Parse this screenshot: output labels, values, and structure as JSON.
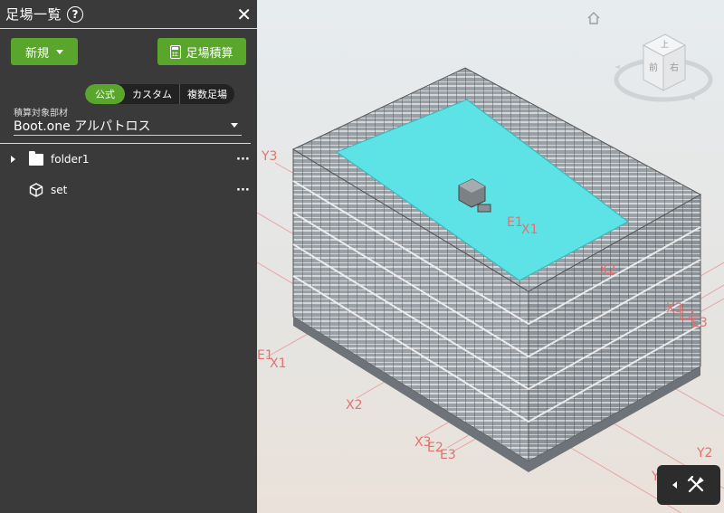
{
  "panel": {
    "title": "足場一覧",
    "help_glyph": "?",
    "close_glyph": "✕",
    "new_button": "新規",
    "estimate_button": "足場積算",
    "tabs": [
      "公式",
      "カスタム",
      "複数足場"
    ],
    "active_tab": "公式",
    "target_label": "積算対象部材",
    "target_value": "Boot.one アルパトロス",
    "tree": [
      {
        "label": "folder1",
        "type": "folder",
        "more": "···"
      },
      {
        "label": "set",
        "type": "set",
        "more": "···"
      }
    ]
  },
  "viewport": {
    "viewcube_faces": {
      "top": "上",
      "front": "前",
      "right": "右"
    },
    "axis_labels": [
      "Y3",
      "E1",
      "X1",
      "X2",
      "X3",
      "E2",
      "E3",
      "Y2",
      "Y1",
      "E1",
      "X1",
      "X2",
      "X3",
      "E2",
      "E3",
      "Y2",
      "Y1"
    ]
  },
  "colors": {
    "accent": "#5aa62c",
    "panel_bg": "#3a3a3a",
    "roof": "#5de3e6",
    "axis": "#e88080"
  }
}
